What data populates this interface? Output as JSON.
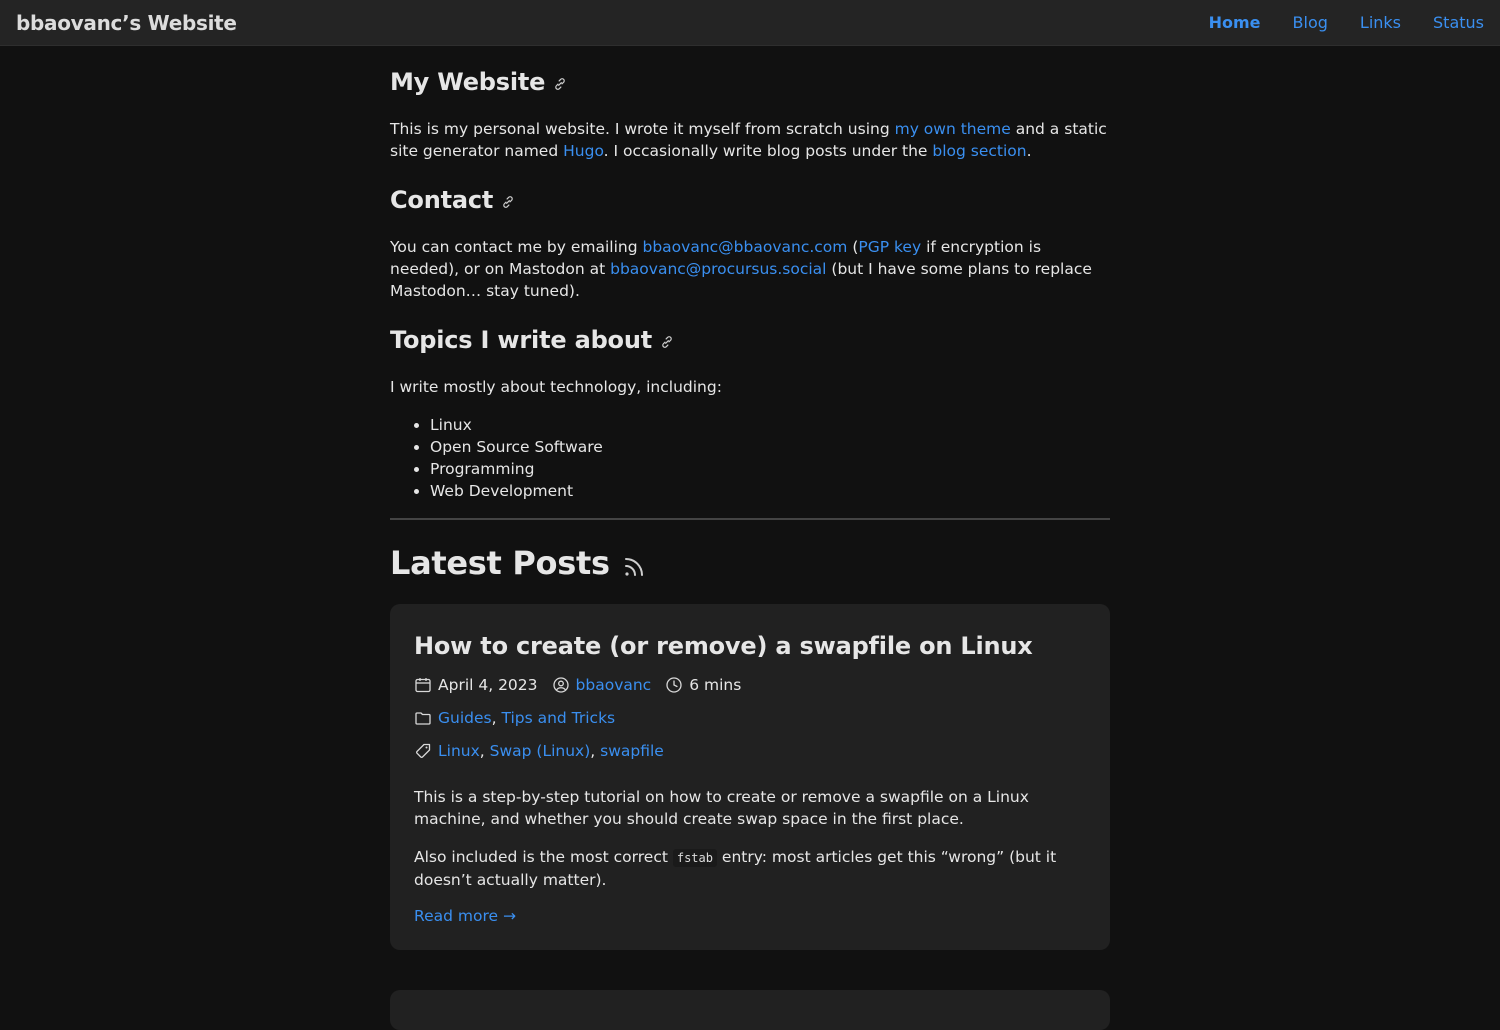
{
  "header": {
    "site_title": "bbaovanc’s Website",
    "nav": [
      {
        "label": "Home",
        "active": true
      },
      {
        "label": "Blog",
        "active": false
      },
      {
        "label": "Links",
        "active": false
      },
      {
        "label": "Status",
        "active": false
      }
    ]
  },
  "sections": {
    "my_website": {
      "title": "My Website",
      "t1": "This is my personal website. I wrote it myself from scratch using ",
      "link1": "my own theme",
      "t2": " and a static site generator named ",
      "link2": "Hugo",
      "t3": ". I occasionally write blog posts under the ",
      "link3": "blog section",
      "t4": "."
    },
    "contact": {
      "title": "Contact",
      "t1": "You can contact me by emailing ",
      "email": "bbaovanc@bbaovanc.com",
      "t2": " (",
      "pgp": "PGP key",
      "t3": " if encryption is needed), or on Mastodon at ",
      "mastodon": "bbaovanc@procursus.social",
      "t4": " (but I have some plans to replace Mastodon… stay tuned)."
    },
    "topics": {
      "title": "Topics I write about",
      "intro": "I write mostly about technology, including:",
      "items": [
        "Linux",
        "Open Source Software",
        "Programming",
        "Web Development"
      ]
    }
  },
  "latest_posts": {
    "title": "Latest Posts",
    "posts": [
      {
        "title": "How to create (or remove) a swapfile on Linux",
        "date": "April 4, 2023",
        "author": "bbaovanc",
        "read_time": "6 mins",
        "categories": [
          "Guides",
          "Tips and Tricks"
        ],
        "tags": [
          "Linux",
          "Swap (Linux)",
          "swapfile"
        ],
        "summary1": "This is a step-by-step tutorial on how to create or remove a swapfile on a Linux machine, and whether you should create swap space in the first place.",
        "summary2_a": "Also included is the most correct ",
        "summary2_code": "fstab",
        "summary2_b": " entry: most articles get this “wrong” (but it doesn’t actually matter).",
        "read_more": "Read more →"
      }
    ]
  },
  "icons": {
    "anchor": "link-icon",
    "rss": "rss-icon",
    "date": "calendar-icon",
    "author": "user-circle-icon",
    "time": "clock-icon",
    "category": "folder-icon",
    "tag": "tag-icon"
  },
  "colors": {
    "background": "#111111",
    "header_bg": "#242424",
    "card_bg": "#212121",
    "link": "#3a8ff0",
    "text": "#e6e6e6"
  }
}
